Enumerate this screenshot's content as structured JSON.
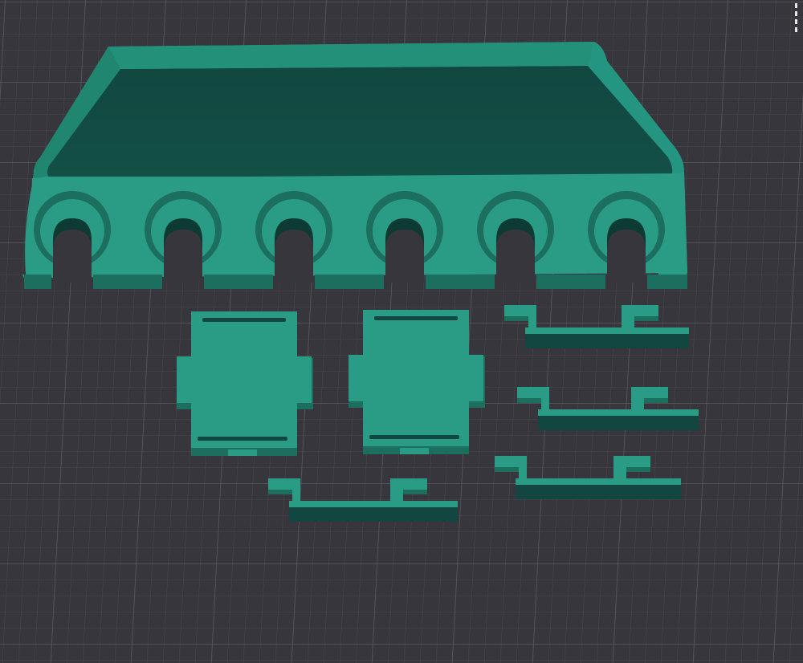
{
  "viewport": {
    "background_color": "#38363d",
    "grid_color_minor": "#4a4850",
    "grid_color_major": "#5a5860"
  },
  "model": {
    "colors": {
      "top": "#2a9c86",
      "side": "#1c6e5f",
      "dark": "#114740",
      "hole": "#0e3a34"
    },
    "holder_slot_count": 6,
    "card_count": 2,
    "bracket_count": 4
  },
  "overlay": {
    "corner_indicator_icon": "dashed-line-icon"
  }
}
